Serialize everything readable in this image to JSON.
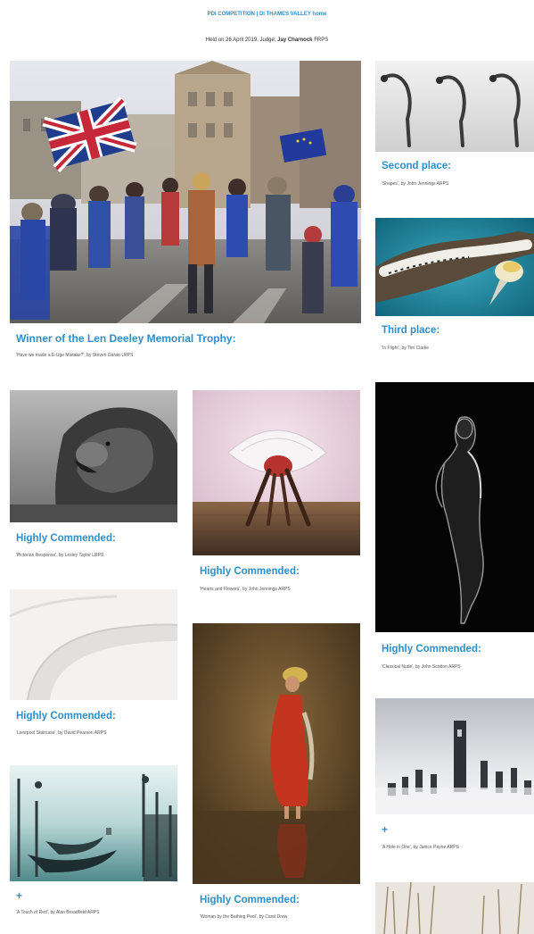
{
  "header": {
    "link_competition": "PDI COMPETITION",
    "separator": " | ",
    "link_home": "DI THAMES VALLEY home",
    "held_prefix": "Held on 26 April 2019. Judge: ",
    "judge_name": "Jay Charnock",
    "judge_suffix": " FRPS"
  },
  "entries": {
    "winner": {
      "award": "Winner of the Len Deeley Memorial Trophy:",
      "caption": "'Have we made a E-Uge Mistake?', by Steven Galvin LRPS"
    },
    "second": {
      "award": "Second place:",
      "caption": "'Shapes', by John Jennings ARPS"
    },
    "third": {
      "award": "Third place:",
      "caption": "'In Flight', by Tim Clarke"
    },
    "hc_lion": {
      "award": "Highly Commended:",
      "caption": "'Pictorian Response', by Lesley Taylor LRPS"
    },
    "hc_ballet": {
      "award": "Highly Commended:",
      "caption": "'Hearts and Flowers', by John Jennings ARPS"
    },
    "hc_nude": {
      "award": "Highly Commended:",
      "caption": "'Classical Nude', by John Scotton ARPS"
    },
    "hc_staircase": {
      "award": "Highly Commended:",
      "caption": "'Liverpool Staircase', by David Pearson ARPS"
    },
    "hc_woman": {
      "award": "Highly Commended:",
      "caption": "'Woman by the Bathing Pool', by Carol Drew"
    },
    "plus_venice": {
      "award": "+",
      "caption": "'A Touch of Red', by Alan Broadfield ARPS"
    },
    "plus_stones": {
      "award": "+",
      "caption": "'A Hole in One', by Janice Payne ARPS"
    }
  }
}
